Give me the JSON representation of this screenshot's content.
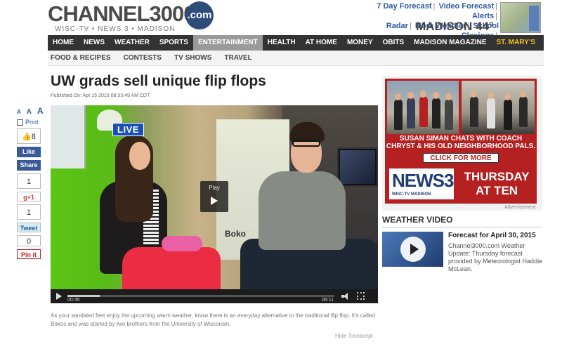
{
  "header": {
    "logo_main": "CHANNEL3000",
    "logo_com": ".com",
    "logo_sub": "WISC-TV • NEWS 3 • MADISON",
    "top_links": [
      "7 Day Forecast",
      "Video Forecast",
      "Alerts",
      "Radar",
      "More Weather",
      "School Closings"
    ],
    "weather": "MADISON 44°"
  },
  "nav": {
    "items": [
      "HOME",
      "NEWS",
      "WEATHER",
      "SPORTS",
      "ENTERTAINMENT",
      "HEALTH",
      "AT HOME",
      "MONEY",
      "OBITS",
      "MADISON MAGAZINE",
      "ST. MARY'S"
    ],
    "active": "ENTERTAINMENT"
  },
  "subnav": {
    "items": [
      "FOOD & RECIPES",
      "CONTESTS",
      "TV SHOWS",
      "TRAVEL"
    ]
  },
  "article": {
    "headline": "UW grads sell unique flip flops",
    "published": "Published On: Apr 15 2015 08:33:49 AM CDT",
    "description": "As your sandaled feet enjoy the upcoming warm weather, know there is an everyday alternative to the traditional flip flop. It's called Bokos and was started by two brothers from the University of Wisconsin.",
    "hide_transcript": "Hide Transcript"
  },
  "share": {
    "font_sizes": [
      "A",
      "A",
      "A"
    ],
    "print": "Print",
    "like_count": "8",
    "like": "Like",
    "share": "Share",
    "share_count": "1",
    "gplus": "g+1",
    "tweet_count": "1",
    "tweet": "Tweet",
    "pin_count": "0",
    "pin": "Pin it"
  },
  "video": {
    "live": "LIVE",
    "play": "Play",
    "banner": "Boko",
    "time_current": "00:45",
    "time_total": "06:11",
    "progress": 0.12
  },
  "ad": {
    "caption": "SUSAN SIMAN CHATS WITH COACH CHRYST & HIS OLD NEIGHBORHOOD PALS.",
    "click": "CLICK FOR MORE",
    "news_logo": "NEWS3",
    "news_sub": "WISC-TV  MADISON",
    "day": "THURSDAY AT TEN",
    "label": "Advertisement"
  },
  "weather_video": {
    "title": "WEATHER VIDEO",
    "headline": "Forecast for April 30, 2015",
    "body": "Channel3000.com Weather Update: Thursday forecast provided by Meteorologist Haddie McLean."
  },
  "colors": {
    "nav_bg": "#333333",
    "nav_active": "#9a9a9a",
    "link_blue": "#2a5aa0",
    "ad_red": "#b52120",
    "facebook": "#3b5998"
  }
}
